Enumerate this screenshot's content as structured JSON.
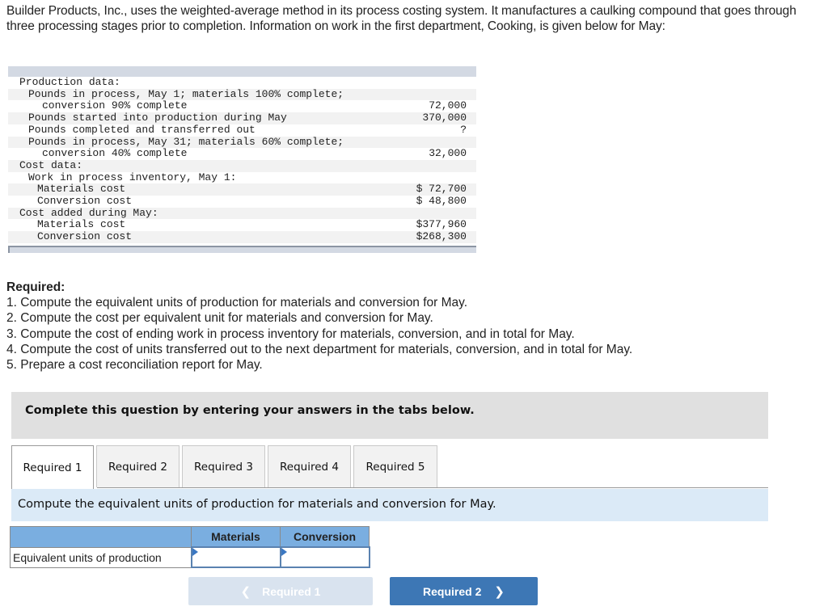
{
  "intro": "Builder Products, Inc., uses the weighted-average method in its process costing system. It manufactures a caulking compound that goes through three processing stages prior to completion. Information on work in the first department, Cooking, is given below for May:",
  "data_table": {
    "rows": [
      {
        "label": "Production data:",
        "value": ""
      },
      {
        "label": "Pounds in process, May 1; materials 100% complete;",
        "value": ""
      },
      {
        "label": "conversion 90% complete",
        "value": "72,000"
      },
      {
        "label": "Pounds started into production during May",
        "value": "370,000"
      },
      {
        "label": "Pounds completed and transferred out",
        "value": "?"
      },
      {
        "label": "Pounds in process, May 31; materials 60% complete;",
        "value": ""
      },
      {
        "label": "conversion 40% complete",
        "value": "32,000"
      },
      {
        "label": "Cost data:",
        "value": ""
      },
      {
        "label": "Work in process inventory, May 1:",
        "value": ""
      },
      {
        "label": "Materials cost",
        "value": "$ 72,700"
      },
      {
        "label": "Conversion cost",
        "value": "$ 48,800"
      },
      {
        "label": "Cost added during May:",
        "value": ""
      },
      {
        "label": "Materials cost",
        "value": "$377,960"
      },
      {
        "label": "Conversion cost",
        "value": "$268,300"
      }
    ]
  },
  "required": {
    "title": "Required:",
    "items": [
      "1. Compute the equivalent units of production for materials and conversion for May.",
      "2. Compute the cost per equivalent unit for materials and conversion for May.",
      "3. Compute the cost of ending work in process inventory for materials, conversion, and in total for May.",
      "4. Compute the cost of units transferred out to the next department for materials, conversion, and in total for May.",
      "5. Prepare a cost reconciliation report for May."
    ]
  },
  "instruction": "Complete this question by entering your answers in the tabs below.",
  "tabs": [
    {
      "label": "Required 1",
      "active": true
    },
    {
      "label": "Required 2",
      "active": false
    },
    {
      "label": "Required 3",
      "active": false
    },
    {
      "label": "Required 4",
      "active": false
    },
    {
      "label": "Required 5",
      "active": false
    }
  ],
  "prompt": "Compute the equivalent units of production for materials and conversion for May.",
  "answer_table": {
    "columns": [
      "Materials",
      "Conversion"
    ],
    "row_label": "Equivalent units of production",
    "values": [
      "",
      ""
    ]
  },
  "nav": {
    "prev_label": "Required 1",
    "next_label": "Required 2",
    "prev_icon": "chevron-left-icon",
    "next_icon": "chevron-right-icon"
  },
  "colors": {
    "accent": "#3d77b5",
    "header_blue": "#7aaee0",
    "prompt_bg": "#dbeaf7"
  }
}
